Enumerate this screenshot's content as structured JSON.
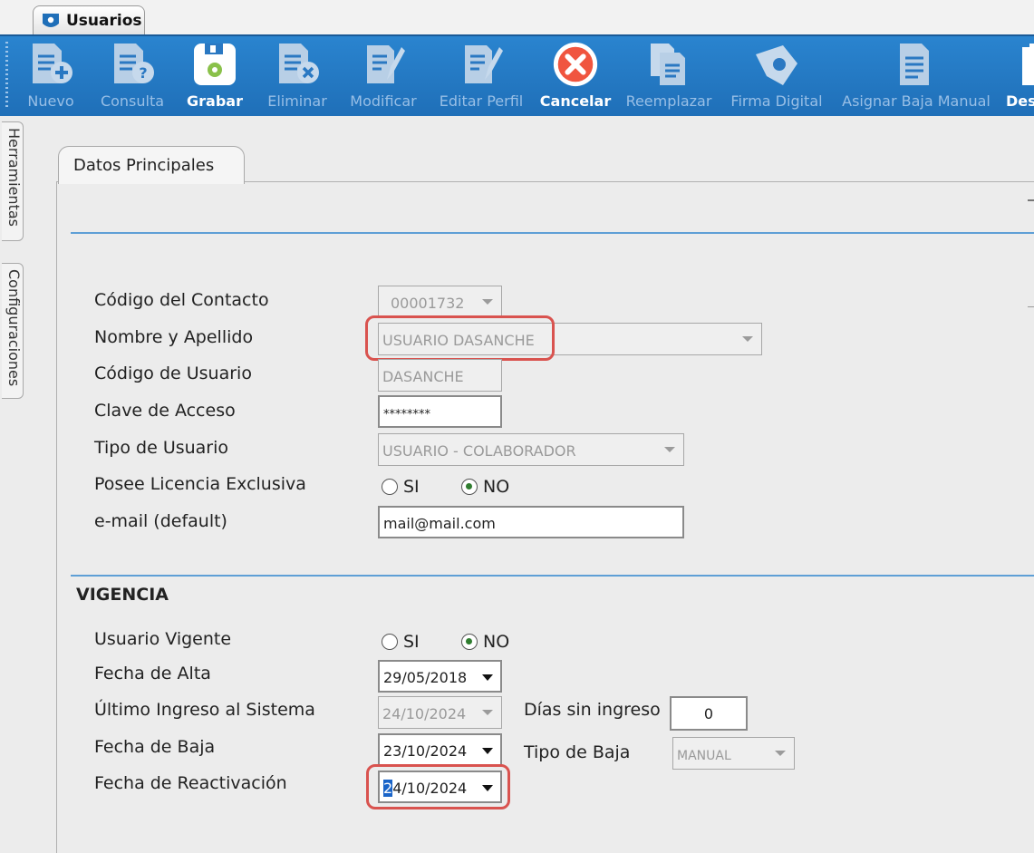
{
  "window": {
    "tab_title": "Usuarios"
  },
  "toolbar": {
    "buttons": [
      {
        "label": "Nuevo",
        "icon": "doc-add-icon",
        "enabled": false
      },
      {
        "label": "Consulta",
        "icon": "doc-help-icon",
        "enabled": false
      },
      {
        "label": "Grabar",
        "icon": "save-disk-icon",
        "enabled": true
      },
      {
        "label": "Eliminar",
        "icon": "doc-delete-icon",
        "enabled": false
      },
      {
        "label": "Modificar",
        "icon": "doc-edit-icon",
        "enabled": false
      },
      {
        "label": "Editar Perfil",
        "icon": "profile-edit-icon",
        "enabled": false
      },
      {
        "label": "Cancelar",
        "icon": "cancel-icon",
        "enabled": true
      },
      {
        "label": "Reemplazar",
        "icon": "doc-copy-icon",
        "enabled": false
      },
      {
        "label": "Firma Digital",
        "icon": "signature-icon",
        "enabled": false
      },
      {
        "label": "Asignar Baja Manual",
        "icon": "doc-assign-icon",
        "enabled": false
      },
      {
        "label": "Des",
        "icon": "doc-more-icon",
        "enabled": true
      }
    ]
  },
  "side_tabs": [
    "Herramientas",
    "Configuraciones"
  ],
  "panel": {
    "tab_label": "Datos Principales"
  },
  "form": {
    "codigo_contacto": {
      "label": "Código del Contacto",
      "value": "00001732"
    },
    "nombre": {
      "label": "Nombre y Apellido",
      "value": "USUARIO DASANCHE"
    },
    "codigo_usuario": {
      "label": "Código de Usuario",
      "value": "DASANCHE"
    },
    "clave": {
      "label": "Clave de Acceso",
      "value": "********"
    },
    "tipo_usuario": {
      "label": "Tipo de Usuario",
      "value": "USUARIO - COLABORADOR"
    },
    "licencia": {
      "label": "Posee Licencia Exclusiva",
      "options": [
        "SI",
        "NO"
      ],
      "selected": "NO"
    },
    "email": {
      "label": "e-mail (default)",
      "value": "mail@mail.com"
    }
  },
  "vigencia": {
    "title": "VIGENCIA",
    "usuario_vigente": {
      "label": "Usuario Vigente",
      "options": [
        "SI",
        "NO"
      ],
      "selected": "NO"
    },
    "fecha_alta": {
      "label": "Fecha de Alta",
      "value": "29/05/2018"
    },
    "ultimo_ingreso": {
      "label": "Último Ingreso al Sistema",
      "value": "24/10/2024"
    },
    "dias_sin_ingreso": {
      "label": "Días sin ingreso",
      "value": "0"
    },
    "fecha_baja": {
      "label": "Fecha de Baja",
      "value": "23/10/2024"
    },
    "tipo_baja": {
      "label": "Tipo de Baja",
      "value": "MANUAL"
    },
    "fecha_reactivacion": {
      "label": "Fecha de Reactivación",
      "value_first_char": "2",
      "value_rest": "4/10/2024"
    }
  },
  "colors": {
    "toolbar_bg": "#1f6fb8",
    "divider": "#5e9fd6",
    "highlight": "#d9534f",
    "radio_on": "#2f7d2f"
  }
}
